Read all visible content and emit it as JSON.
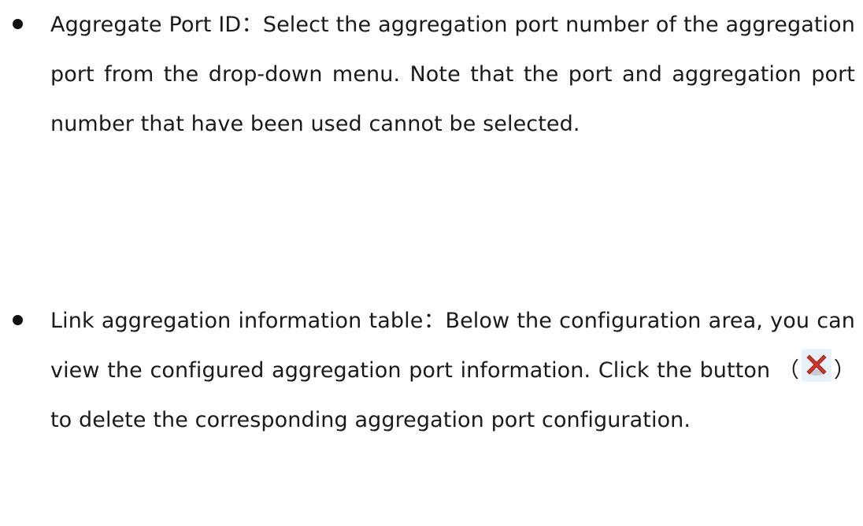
{
  "bullets": [
    {
      "label": "Aggregate Port ID",
      "separator": "：",
      "text": "Select the aggregation port number of the aggregation port from the drop-down menu. Note that the port and aggregation port number that have been used cannot be selected."
    },
    {
      "label": "Link aggregation information table",
      "separator": "：",
      "text_before_icon": "Below the configuration area, you can view the configured aggregation port information. Click the button （",
      "icon": "delete-x-icon",
      "text_after_icon": "） to delete the corresponding aggregation port configuration."
    }
  ],
  "colors": {
    "text": "#1a1a1a",
    "icon_red": "#c8352b",
    "icon_bg": "#e9f1fa"
  }
}
